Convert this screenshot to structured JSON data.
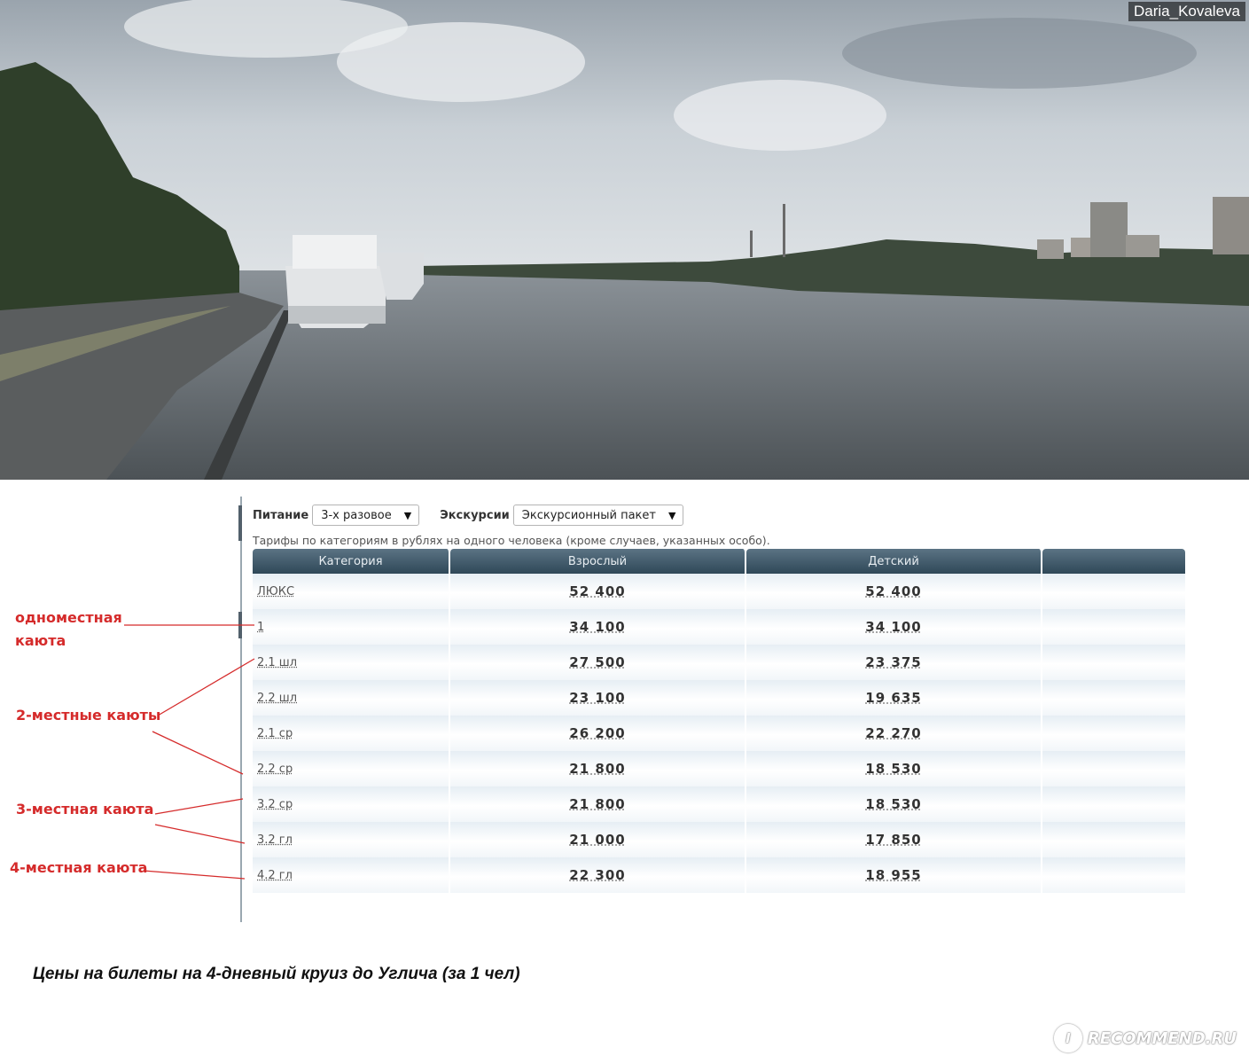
{
  "photo": {
    "description_icon": "river-landscape-photo",
    "author": "Daria_Kovaleva"
  },
  "filters": {
    "meals_label": "Питание",
    "meals_value": "3-х разовое",
    "excursions_label": "Экскурсии",
    "excursions_value": "Экскурсионный пакет",
    "note": "Тарифы по категориям в рублях на одного человека (кроме случаев, указанных особо)."
  },
  "table": {
    "headers": [
      "Категория",
      "Взрослый",
      "Детский",
      ""
    ],
    "rows": [
      {
        "category": "ЛЮКС",
        "adult": "52 400",
        "child": "52 400"
      },
      {
        "category": "1",
        "adult": "34 100",
        "child": "34 100"
      },
      {
        "category": "2.1 шл",
        "adult": "27 500",
        "child": "23 375"
      },
      {
        "category": "2.2 шл",
        "adult": "23 100",
        "child": "19 635"
      },
      {
        "category": "2.1 ср",
        "adult": "26 200",
        "child": "22 270"
      },
      {
        "category": "2.2 ср",
        "adult": "21 800",
        "child": "18 530"
      },
      {
        "category": "3.2 ср",
        "adult": "21 800",
        "child": "18 530"
      },
      {
        "category": "3.2 гл",
        "adult": "21 000",
        "child": "17 850"
      },
      {
        "category": "4.2 гл",
        "adult": "22 300",
        "child": "18 955"
      }
    ]
  },
  "annotations": {
    "single_line1": "одноместная",
    "single_line2": "каюта",
    "double": "2-местные каюты",
    "triple": "3-местная каюта",
    "quad": "4-местная каюта",
    "color": "#d52b2b"
  },
  "caption": "Цены на билеты на 4-дневный круиз до Углича (за 1 чел)",
  "brand": {
    "text": "RECOMMEND.RU",
    "mark": "I"
  }
}
